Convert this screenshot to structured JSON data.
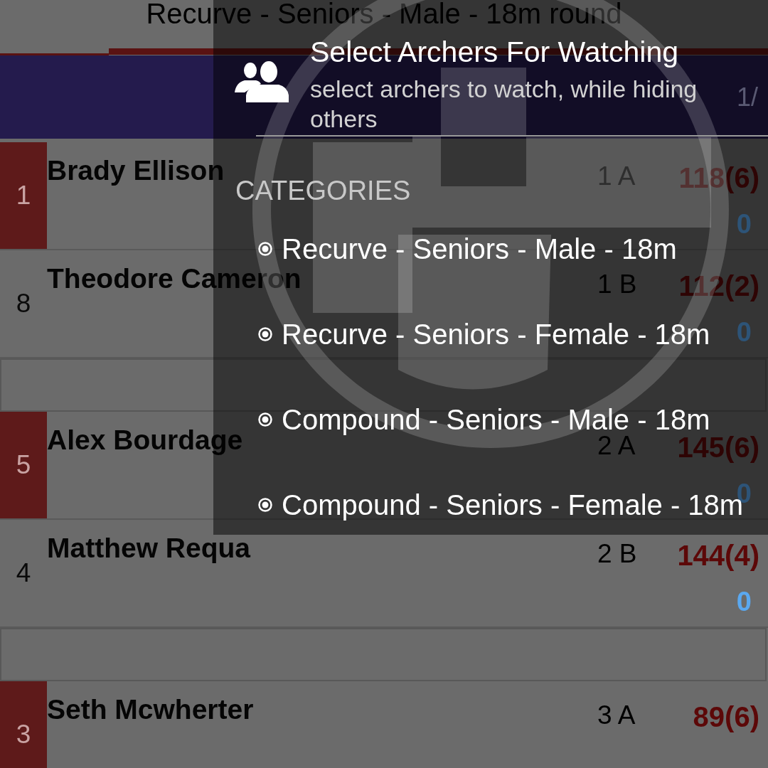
{
  "list": {
    "title": "Recurve - Seniors - Male - 18m round",
    "page_indicator": "1/",
    "rows": [
      {
        "kind": "archer",
        "rank": "1",
        "highlighted": true,
        "name": "Brady Ellison",
        "target": "1 A",
        "score": "118(6)",
        "column_5": "0"
      },
      {
        "kind": "archer",
        "rank": "8",
        "highlighted": false,
        "name": "Theodore Cameron",
        "target": "1 B",
        "score": "112(2)",
        "column_5": "0"
      },
      {
        "kind": "separator"
      },
      {
        "kind": "archer",
        "rank": "5",
        "highlighted": true,
        "name": "Alex Bourdage",
        "target": "2 A",
        "score": "145(6)",
        "column_5": "0"
      },
      {
        "kind": "archer",
        "rank": "4",
        "highlighted": false,
        "name": "Matthew Requa",
        "target": "2 B",
        "score": "144(4)",
        "column_5": "0"
      },
      {
        "kind": "separator"
      },
      {
        "kind": "archer",
        "rank": "3",
        "highlighted": true,
        "name": "Seth Mcwherter",
        "target": "3 A",
        "score": "89(6)"
      }
    ]
  },
  "dialog": {
    "title": "Select Archers For Watching",
    "subtitle": "select archers to watch, while hiding others",
    "section": "CATEGORIES",
    "categories": [
      {
        "label": "Recurve - Seniors - Male - 18m",
        "checked": true
      },
      {
        "label": "Recurve - Seniors - Female - 18m",
        "checked": true
      },
      {
        "label": "Compound - Seniors - Male - 18m",
        "checked": true
      },
      {
        "label": "Compound - Seniors - Female - 18m",
        "checked": true
      }
    ]
  }
}
